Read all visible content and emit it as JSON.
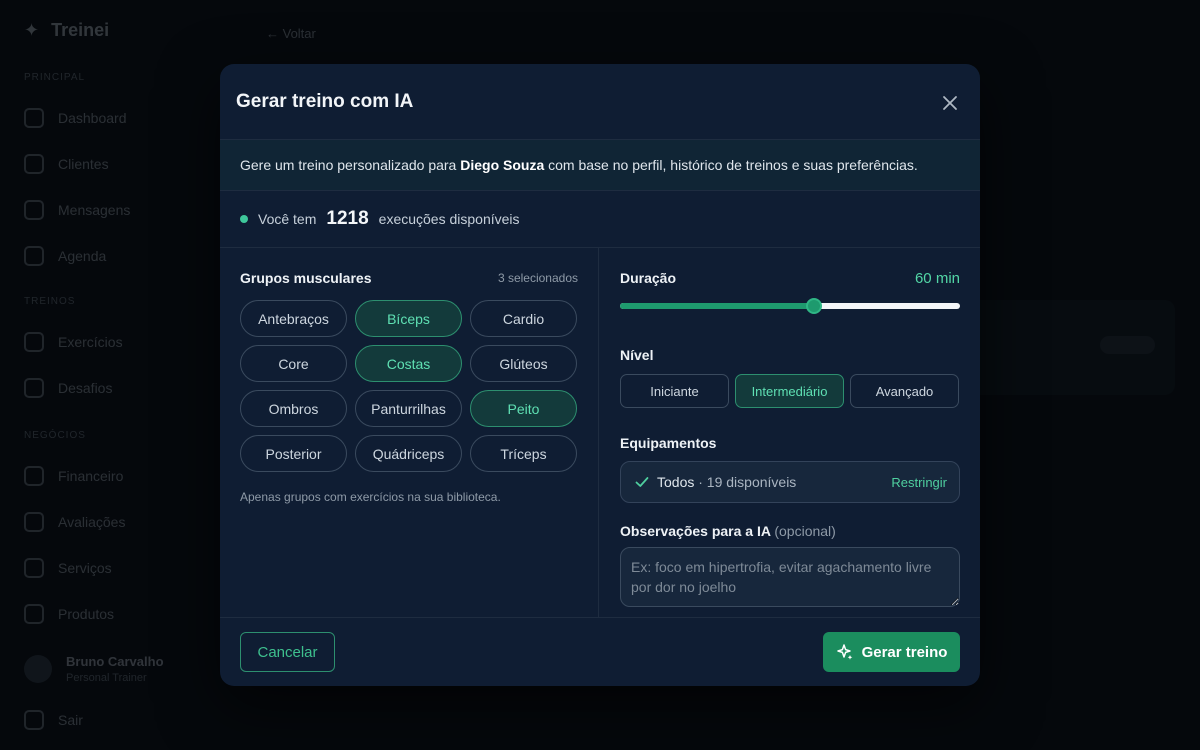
{
  "background": {
    "app_name": "Treinei",
    "sections": [
      "Principal",
      "Treinos",
      "Negócios"
    ],
    "nav_items": [
      "Dashboard",
      "Clientes",
      "Mensagens",
      "Agenda",
      "Exercícios",
      "Desafios",
      "Financeiro",
      "Avaliações",
      "Serviços",
      "Produtos"
    ],
    "user_name": "Bruno Carvalho",
    "user_role": "Personal Trainer",
    "logout": "Sair",
    "back_link": "← Voltar"
  },
  "modal": {
    "title": "Gerar treino com IA",
    "info_prefix": "Gere um treino personalizado para ",
    "client_name": "Diego Souza",
    "info_suffix": " com base no perfil, histórico de treinos e suas preferências.",
    "credits_prefix": "Você tem",
    "credits_count": "1218",
    "credits_suffix": "execuções disponíveis"
  },
  "muscle_groups": {
    "label": "Grupos musculares",
    "selected_count": "3 selecionados",
    "items": [
      {
        "label": "Antebraços",
        "selected": false
      },
      {
        "label": "Bíceps",
        "selected": true
      },
      {
        "label": "Cardio",
        "selected": false
      },
      {
        "label": "Core",
        "selected": false
      },
      {
        "label": "Costas",
        "selected": true
      },
      {
        "label": "Glúteos",
        "selected": false
      },
      {
        "label": "Ombros",
        "selected": false
      },
      {
        "label": "Panturrilhas",
        "selected": false
      },
      {
        "label": "Peito",
        "selected": true
      },
      {
        "label": "Posterior",
        "selected": false
      },
      {
        "label": "Quádriceps",
        "selected": false
      },
      {
        "label": "Tríceps",
        "selected": false
      }
    ],
    "hint": "Apenas grupos com exercícios na sua biblioteca."
  },
  "duration": {
    "label": "Duração",
    "value_text": "60 min",
    "slider_fraction": 0.57
  },
  "level": {
    "label": "Nível",
    "options": [
      {
        "label": "Iniciante",
        "selected": false
      },
      {
        "label": "Intermediário",
        "selected": true
      },
      {
        "label": "Avançado",
        "selected": false
      }
    ]
  },
  "equipment": {
    "label": "Equipamentos",
    "value": "Todos",
    "available": " · 19 disponíveis",
    "restrict_label": "Restringir"
  },
  "notes": {
    "label": "Observações para a IA",
    "optional": "(opcional)",
    "placeholder": "Ex: foco em hipertrofia, evitar agachamento livre por dor no joelho",
    "value": ""
  },
  "footer": {
    "cancel_label": "Cancelar",
    "generate_label": "Gerar treino"
  },
  "colors": {
    "accent": "#1b8d5e",
    "accent_text": "#5fe0b3",
    "modal_bg": "#0f1d33"
  }
}
